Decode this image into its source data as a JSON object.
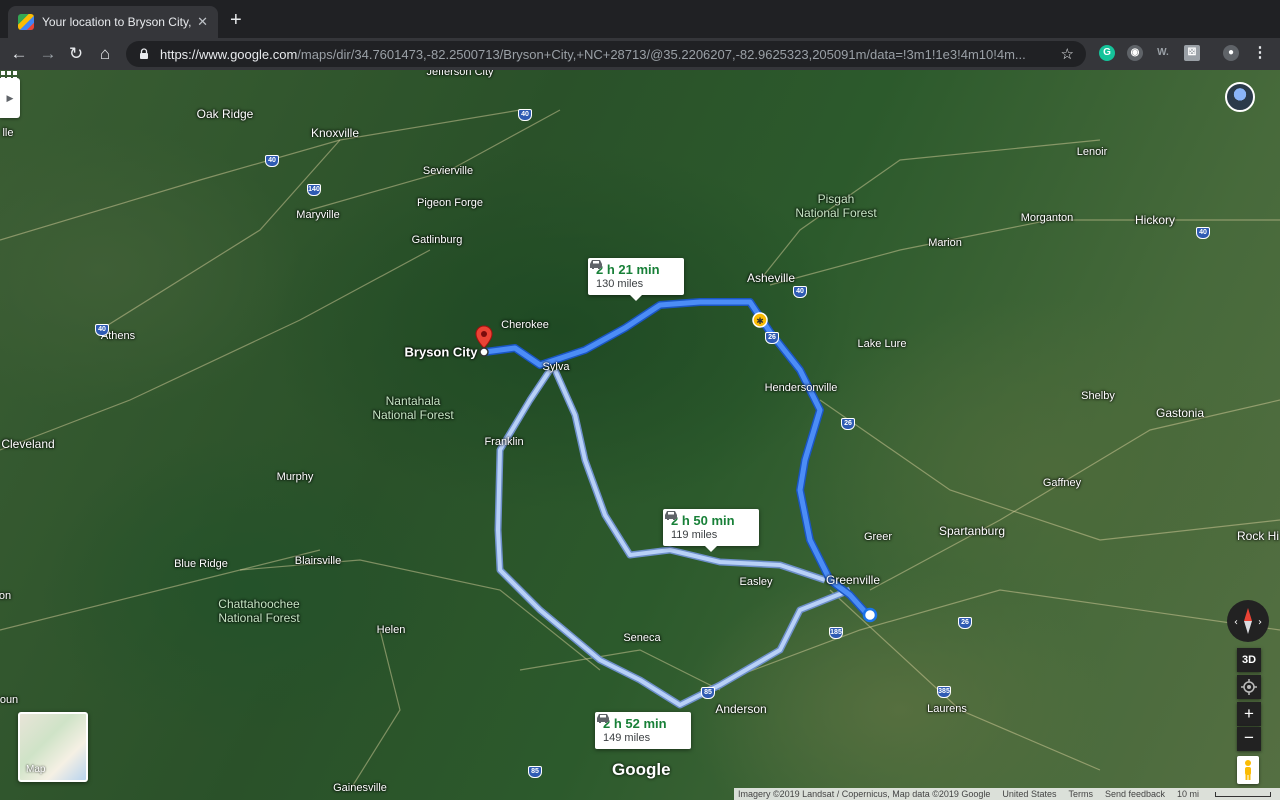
{
  "browser": {
    "tab_title": "Your location to Bryson City, N",
    "tab_close": "✕",
    "new_tab": "+",
    "back": "←",
    "forward": "→",
    "reload": "↻",
    "home": "⌂",
    "url_host": "https://www.google.com",
    "url_path": "/maps/dir/34.7601473,-82.2500713/Bryson+City,+NC+28713/@35.2206207,-82.9625323,205091m/data=!3m1!1e3!4m10!4m...",
    "star": "☆",
    "extensions": [
      {
        "name": "grammarly-icon",
        "glyph": "G",
        "color": "#15c39a"
      },
      {
        "name": "extension-circle-icon",
        "glyph": "◉",
        "color": "#9aa0a6"
      },
      {
        "name": "extension-w-icon",
        "glyph": "W.",
        "color": "#35363a"
      },
      {
        "name": "extension-square-icon",
        "glyph": "⚄",
        "color": "#9aa0a6"
      },
      {
        "name": "profile-icon",
        "glyph": "●",
        "color": "#5f6368"
      },
      {
        "name": "menu-icon",
        "glyph": "⋮",
        "color": "#35363a"
      }
    ]
  },
  "map": {
    "view": "Satellite",
    "labels": [
      {
        "id": "jefferson-city",
        "text": "Jefferson City",
        "type": "city"
      },
      {
        "id": "oak-ridge",
        "text": "Oak Ridge",
        "type": "city"
      },
      {
        "id": "knoxville",
        "text": "Knoxville",
        "type": "city"
      },
      {
        "id": "sevierville",
        "text": "Sevierville",
        "type": "town"
      },
      {
        "id": "pigeon-forge",
        "text": "Pigeon Forge",
        "type": "town"
      },
      {
        "id": "maryville",
        "text": "Maryville",
        "type": "town"
      },
      {
        "id": "gatlinburg",
        "text": "Gatlinburg",
        "type": "town"
      },
      {
        "id": "athens",
        "text": "Athens",
        "type": "town"
      },
      {
        "id": "cherokee",
        "text": "Cherokee",
        "type": "town"
      },
      {
        "id": "sylva",
        "text": "Sylva",
        "type": "town"
      },
      {
        "id": "franklin",
        "text": "Franklin",
        "type": "town"
      },
      {
        "id": "cleveland",
        "text": "Cleveland",
        "type": "city"
      },
      {
        "id": "murphy",
        "text": "Murphy",
        "type": "town"
      },
      {
        "id": "blue-ridge",
        "text": "Blue Ridge",
        "type": "town"
      },
      {
        "id": "blairsville",
        "text": "Blairsville",
        "type": "town"
      },
      {
        "id": "helen",
        "text": "Helen",
        "type": "town"
      },
      {
        "id": "gainesville",
        "text": "Gainesville",
        "type": "town"
      },
      {
        "id": "asheville",
        "text": "Asheville",
        "type": "city"
      },
      {
        "id": "hendersonville",
        "text": "Hendersonville",
        "type": "town"
      },
      {
        "id": "lake-lure",
        "text": "Lake Lure",
        "type": "town"
      },
      {
        "id": "marion",
        "text": "Marion",
        "type": "town"
      },
      {
        "id": "morganton",
        "text": "Morganton",
        "type": "town"
      },
      {
        "id": "lenoir",
        "text": "Lenoir",
        "type": "town"
      },
      {
        "id": "hickory",
        "text": "Hickory",
        "type": "city"
      },
      {
        "id": "shelby",
        "text": "Shelby",
        "type": "town"
      },
      {
        "id": "gastonia",
        "text": "Gastonia",
        "type": "city"
      },
      {
        "id": "gaffney",
        "text": "Gaffney",
        "type": "town"
      },
      {
        "id": "spartanburg",
        "text": "Spartanburg",
        "type": "city"
      },
      {
        "id": "greer",
        "text": "Greer",
        "type": "town"
      },
      {
        "id": "greenville",
        "text": "Greenville",
        "type": "city"
      },
      {
        "id": "easley",
        "text": "Easley",
        "type": "town"
      },
      {
        "id": "seneca",
        "text": "Seneca",
        "type": "town"
      },
      {
        "id": "anderson",
        "text": "Anderson",
        "type": "city"
      },
      {
        "id": "laurens",
        "text": "Laurens",
        "type": "town"
      },
      {
        "id": "rock-hill",
        "text": "Rock Hi",
        "type": "city"
      },
      {
        "id": "lle",
        "text": "lle",
        "type": "town"
      },
      {
        "id": "on",
        "text": "on",
        "type": "town"
      },
      {
        "id": "oun",
        "text": "oun",
        "type": "town"
      }
    ],
    "forests": [
      {
        "id": "pisgah",
        "line1": "Pisgah",
        "line2": "National Forest"
      },
      {
        "id": "nantahala",
        "line1": "Nantahala",
        "line2": "National Forest"
      },
      {
        "id": "chattahoochee",
        "line1": "Chattahoochee",
        "line2": "National Forest"
      }
    ],
    "shields": [
      "40",
      "40",
      "140",
      "40",
      "40",
      "26",
      "26",
      "185",
      "85",
      "385",
      "26",
      "85",
      "40"
    ],
    "destination": "Bryson City",
    "routes": [
      {
        "id": "route-primary",
        "duration": "2 h 21 min",
        "distance": "130 miles",
        "selected": true
      },
      {
        "id": "route-alt-1",
        "duration": "2 h 50 min",
        "distance": "119 miles",
        "selected": false
      },
      {
        "id": "route-alt-2",
        "duration": "2 h 52 min",
        "distance": "149 miles",
        "selected": false
      }
    ],
    "route_colors": {
      "primary": "#4285f4",
      "primary_outline": "#1a56c4",
      "alt": "#a9c7f5"
    },
    "layers_label": "Map",
    "google_logo": "Google",
    "footer": {
      "imagery": "Imagery ©2019 Landsat / Copernicus, Map data ©2019 Google",
      "region": "United States",
      "terms": "Terms",
      "feedback": "Send feedback",
      "scale": "10 mi"
    },
    "controls": {
      "tilt": "3D",
      "zoom_in": "+",
      "zoom_out": "−"
    }
  }
}
